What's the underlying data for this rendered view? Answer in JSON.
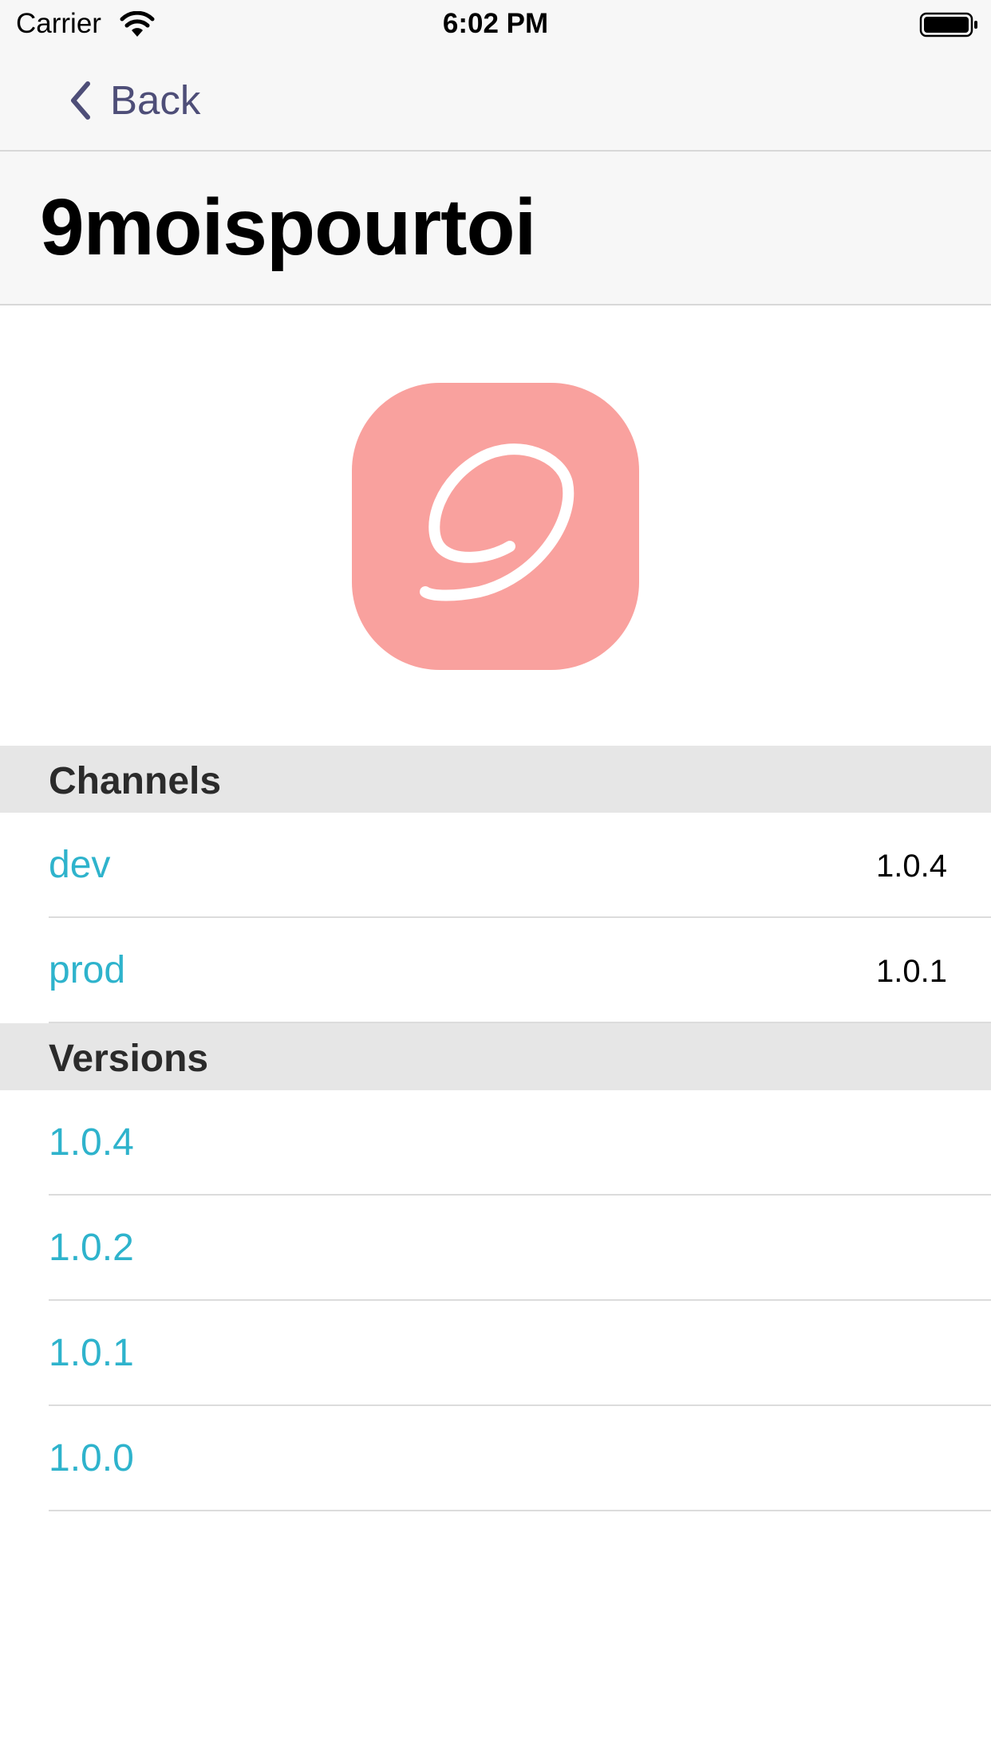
{
  "status_bar": {
    "carrier": "Carrier",
    "time": "6:02 PM"
  },
  "nav": {
    "back_label": "Back"
  },
  "page": {
    "title": "9moispourtoi",
    "app_icon": "app-logo-9-icon",
    "accent_color": "#2eb3cc",
    "icon_background": "#f9a19e"
  },
  "channels": {
    "header": "Channels",
    "items": [
      {
        "name": "dev",
        "version": "1.0.4"
      },
      {
        "name": "prod",
        "version": "1.0.1"
      }
    ]
  },
  "versions": {
    "header": "Versions",
    "items": [
      {
        "label": "1.0.4"
      },
      {
        "label": "1.0.2"
      },
      {
        "label": "1.0.1"
      },
      {
        "label": "1.0.0"
      }
    ]
  }
}
